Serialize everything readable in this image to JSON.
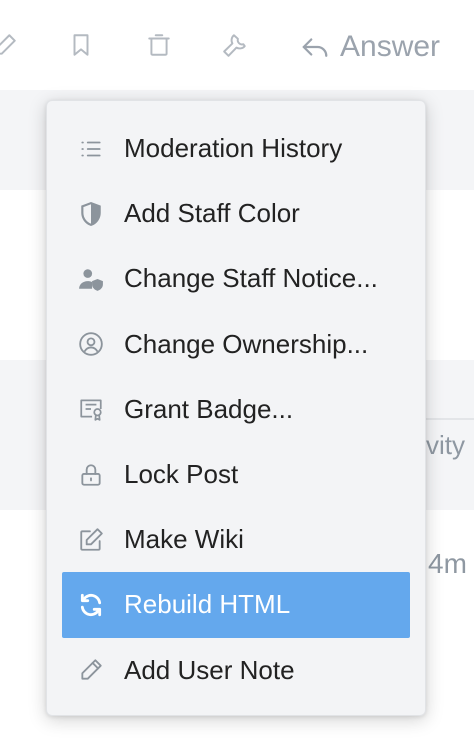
{
  "toolbar": {
    "icons": [
      "pencil-icon",
      "bookmark-icon",
      "trash-icon",
      "wrench-icon",
      "reply-icon"
    ],
    "answer_label": "Answer"
  },
  "background": {
    "column_header_partial": "vity",
    "time_partial": "4m"
  },
  "menu": {
    "items": [
      {
        "label": "Moderation History",
        "icon": "list-icon"
      },
      {
        "label": "Add Staff Color",
        "icon": "shield-icon"
      },
      {
        "label": "Change Staff Notice...",
        "icon": "user-shield-icon"
      },
      {
        "label": "Change Ownership...",
        "icon": "user-circle-icon"
      },
      {
        "label": "Grant Badge...",
        "icon": "certificate-icon"
      },
      {
        "label": "Lock Post",
        "icon": "lock-icon"
      },
      {
        "label": "Make Wiki",
        "icon": "edit-square-icon"
      },
      {
        "label": "Rebuild HTML",
        "icon": "sync-icon",
        "active": true
      },
      {
        "label": "Add User Note",
        "icon": "pencil-icon"
      }
    ]
  },
  "colors": {
    "accent": "#64a8ed",
    "icon_gray": "#8c949c",
    "toolbar_gray": "#9ba3ad",
    "menu_bg": "#f3f4f6"
  }
}
